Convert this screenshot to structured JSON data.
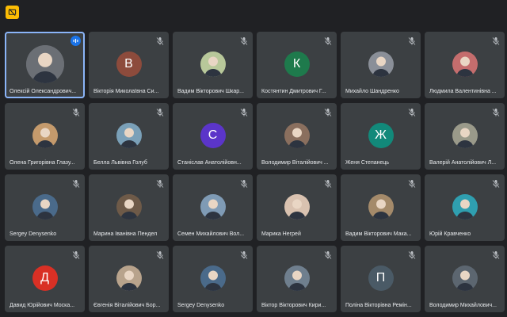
{
  "colors": {
    "background": "#202124",
    "tile": "#3c4043",
    "active_border": "#8ab4f8",
    "tile_name_text": "#e8eaed",
    "notification_icon": "#fbbc04",
    "speaking_badge": "#1a73e8"
  },
  "top_icon": "present-to-all-off-icon",
  "participants": [
    {
      "name": "Олексій Олександрович...",
      "avatar_type": "photo",
      "avatar_color": "#6b6f75",
      "speaking": true,
      "muted": false,
      "active": true
    },
    {
      "name": "Вікторія Миколаївна Си...",
      "avatar_type": "letter",
      "initial": "В",
      "avatar_color": "#8d4b3c",
      "muted": true
    },
    {
      "name": "Вадим Вікторович Шкар...",
      "avatar_type": "photo",
      "avatar_color": "#b8c89a",
      "muted": true
    },
    {
      "name": "Костянтин Дмитрович Г...",
      "avatar_type": "letter",
      "initial": "К",
      "avatar_color": "#1e7a4c",
      "muted": true
    },
    {
      "name": "Михайло Шандренко",
      "avatar_type": "photo",
      "avatar_color": "#8a8f98",
      "muted": true
    },
    {
      "name": "Людмила Валентинівна ...",
      "avatar_type": "photo",
      "avatar_color": "#c46d6d",
      "muted": true
    },
    {
      "name": "Олена Григорівна Глазу...",
      "avatar_type": "photo",
      "avatar_color": "#c49a6c",
      "muted": true
    },
    {
      "name": "Белла Львівна Голуб",
      "avatar_type": "photo",
      "avatar_color": "#7aa0b8",
      "muted": true
    },
    {
      "name": "Станіслав Анатолійовн...",
      "avatar_type": "letter",
      "initial": "С",
      "avatar_color": "#5b35c9",
      "muted": true
    },
    {
      "name": "Володимир Віталійович ...",
      "avatar_type": "photo",
      "avatar_color": "#8a6f5e",
      "muted": true
    },
    {
      "name": "Женя Степанець",
      "avatar_type": "letter",
      "initial": "Ж",
      "avatar_color": "#12897a",
      "muted": true
    },
    {
      "name": "Валерій Анатолійович Л...",
      "avatar_type": "photo",
      "avatar_color": "#9a9a8a",
      "muted": true
    },
    {
      "name": "Sergey Denysenko",
      "avatar_type": "photo",
      "avatar_color": "#4a6a8a",
      "muted": true
    },
    {
      "name": "Марина Іванівна Пендел",
      "avatar_type": "photo",
      "avatar_color": "#6e5a48",
      "muted": true
    },
    {
      "name": "Семен Михайлович Вол...",
      "avatar_type": "photo",
      "avatar_color": "#7f9bb5",
      "muted": true
    },
    {
      "name": "Марика Негрей",
      "avatar_type": "photo",
      "avatar_color": "#d9c2b0",
      "muted": true
    },
    {
      "name": "Вадим Вікторович Мака...",
      "avatar_type": "photo",
      "avatar_color": "#a48a6a",
      "muted": true
    },
    {
      "name": "Юрій Кравченко",
      "avatar_type": "photo",
      "avatar_color": "#2f9fb0",
      "muted": true
    },
    {
      "name": "Давид Юрійович Моска...",
      "avatar_type": "letter",
      "initial": "Д",
      "avatar_color": "#d93025",
      "muted": true
    },
    {
      "name": "Євгенія Віталійович Бор...",
      "avatar_type": "photo",
      "avatar_color": "#b8a38c",
      "muted": true
    },
    {
      "name": "Sergey Denysenko",
      "avatar_type": "photo",
      "avatar_color": "#4a6a8a",
      "muted": true
    },
    {
      "name": "Віктор Вікторович Кири...",
      "avatar_type": "photo",
      "avatar_color": "#6f7f8e",
      "muted": true
    },
    {
      "name": "Поліна Вікторівна Ремін...",
      "avatar_type": "letter",
      "initial": "П",
      "avatar_color": "#4a5a66",
      "muted": true
    },
    {
      "name": "Володимир Михайлович...",
      "avatar_type": "photo",
      "avatar_color": "#5c6670",
      "muted": true
    }
  ]
}
